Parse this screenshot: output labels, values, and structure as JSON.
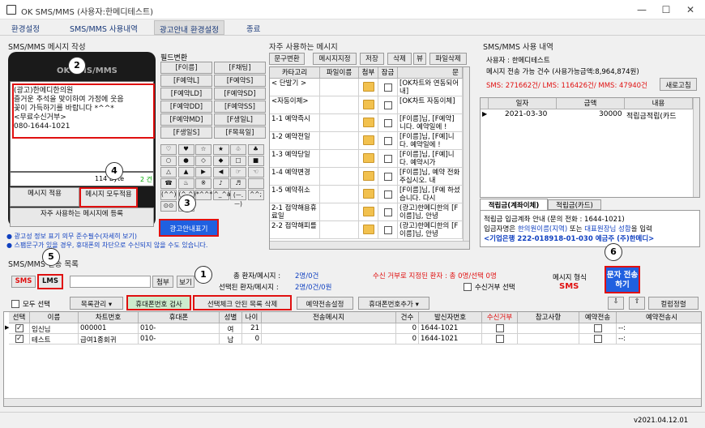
{
  "window": {
    "title": "OK SMS/MMS (사용자:한메디테스트)",
    "minimize": "—",
    "maximize": "☐",
    "close": "✕"
  },
  "menu": [
    "환경설정",
    "SMS/MMS 사용내역",
    "광고안내 환경설정",
    "종료"
  ],
  "compose": {
    "title": "SMS/MMS 메시지 작성",
    "phone_brand": "OK SMS/MMS",
    "message_lines": [
      "(광고)한메디한의원",
      "즐거운 추석을 맞이하여 가정에 웃음",
      "꽃이 가득하기를 바랍니다 *^^*",
      "<무료수신거부>",
      "080-1644-1021"
    ],
    "byte_count": "114 Byte",
    "page_count": "2 건",
    "btn_apply": "메시지 적용",
    "btn_apply_all": "메시지 모두적용",
    "btn_register": "자주 사용하는 메시지에 등록",
    "field_title": "필드변환",
    "fields": [
      "[F이름]",
      "[F채팅]",
      "[F예약L]",
      "[F예약S]",
      "[F예약LD]",
      "[F예약SD]",
      "[F예약DD]",
      "[F예약SS]",
      "[F예약MD]",
      "[F생일L]",
      "[F생일L]",
      "[F생일S]",
      "[F목욕일]"
    ],
    "symbols": [
      "♡",
      "♥",
      "☆",
      "★",
      "♧",
      "♣",
      "○",
      "●",
      "◇",
      "◆",
      "□",
      "■",
      "△",
      "▲",
      "▶",
      "◀",
      "☞",
      "☜",
      "☎",
      "♨",
      "※",
      "♪",
      "♬",
      "",
      "(^^)",
      "(^.^)",
      "*^^*",
      "^_^a",
      "(ㅡ.ㅡ)",
      "^^;",
      "⊙⊙",
      "(-_-)"
    ],
    "ad_btn": "광고안내표기"
  },
  "notices": [
    "● 광고성 정보 표기 의무 준수필수(자세히 보기)",
    "● 스팸문구가 있을 경우, 휴대폰의 차단으로 수신되지 않을 수도 있습니다."
  ],
  "frequent": {
    "title": "자주 사용하는 메시지",
    "buttons": [
      "문구변환",
      "메시지지정",
      "저장",
      "삭제",
      "뷰",
      "파일삭제"
    ],
    "headers": [
      "카타고리",
      "파일이름",
      "첨부",
      "잠금",
      "문"
    ],
    "rows": [
      {
        "cat": "< 단발기 >",
        "msg": "[OK차트와 연동되어 내]"
      },
      {
        "cat": "<자동이체>",
        "msg": "[OK차트 자동이체]"
      },
      {
        "cat": "1-1 예약즉시",
        "msg": "[F이름]님, [F예약]니다. 예약일에 !"
      },
      {
        "cat": "1-2 예약전일",
        "msg": "[F이름]님, [F예]니다. 예약일에 !"
      },
      {
        "cat": "1-3 예약당일",
        "msg": "[F이름]님, [F예]니다. 예약시가"
      },
      {
        "cat": "1-4 예약변경",
        "msg": "[F이름]님, 예약 전화주십시오. 내"
      },
      {
        "cat": "1-5 예약취소",
        "msg": "[F이름]님, [F예 하셨습니다. 다시"
      },
      {
        "cat": "2-1 접약해용휴료일",
        "msg": "(광고)한메디한의 [F이름]님, 안녕"
      },
      {
        "cat": "2-2 접약해피를",
        "msg": "(광고)한메디한의 [F이름]님, 안녕"
      }
    ]
  },
  "usage": {
    "title": "SMS/MMS 사용 내역",
    "user_label": "사용자 : 한메디테스트",
    "remain": "메시지 전송 가능 건수 (사용가능금액:8,964,874원)",
    "counts": "SMS: 271662건/ LMS: 116426건/ MMS: 47940건",
    "refresh": "새로고침",
    "headers": [
      "일자",
      "금액",
      "내용"
    ],
    "rows": [
      {
        "date": "2021-03-30",
        "amount": "30000",
        "desc": "적립금적립(카드"
      }
    ],
    "tab1": "적립금(계좌이체)",
    "tab2": "적립금(카드)",
    "info1": "적립금 입금계좌 안내 (문의 전화 : 1644-1021)",
    "info2a": "입금자명은 ",
    "info2b": "한의원이름(지역)",
    "info2c": " 또는 ",
    "info2d": "대표원장님 성함",
    "info2e": "을 입력",
    "info3": "<기업은행 222-018918-01-030 예금주 (주)한메디>"
  },
  "recipients": {
    "title": "SMS/MMS 전송 목록",
    "sms": "SMS",
    "lms": "LMS",
    "attach": "첨부",
    "view": "보기",
    "total_label": "총 환자/메시지 :",
    "total_val": "2명/0건",
    "sel_label": "선택된 환자/메시지 :",
    "sel_val": "2명/0건/0원",
    "reject": "수신 거부로 지정된 환자 : 총 0명/선택 0명",
    "reject_chk": "수신거부 선택",
    "format_label": "메시지 형식",
    "format_val": "SMS",
    "send": "문자 전송하기",
    "select_all": "모두 선택",
    "list_mgmt": "목록관리",
    "phone_check": "휴대폰번호 검사",
    "delete_unchecked": "선택체크 안된 목록 삭제",
    "reserve": "예약전송설정",
    "add_phone": "휴대폰번호추가",
    "sort": "컬럼정렬",
    "headers": [
      "선택",
      "이름",
      "차트번호",
      "휴대폰",
      "성별",
      "나이",
      "전송메시지",
      "건수",
      "발신자번호",
      "수신거부",
      "참고사항",
      "예약전송",
      "예약전송시"
    ],
    "rows": [
      {
        "name": "임신님",
        "chart": "000001",
        "phone": "010-",
        "sex": "여",
        "age": "21",
        "count": "0",
        "sender": "1644-1021",
        "res": "--:"
      },
      {
        "name": "테스트",
        "chart": "급여1종회귀",
        "phone": "010-",
        "sex": "남",
        "age": "0",
        "count": "0",
        "sender": "1644-1021",
        "res": "--:"
      }
    ]
  },
  "version": "v2021.04.12.01",
  "markers": [
    "1",
    "2",
    "3",
    "4",
    "5",
    "6"
  ]
}
